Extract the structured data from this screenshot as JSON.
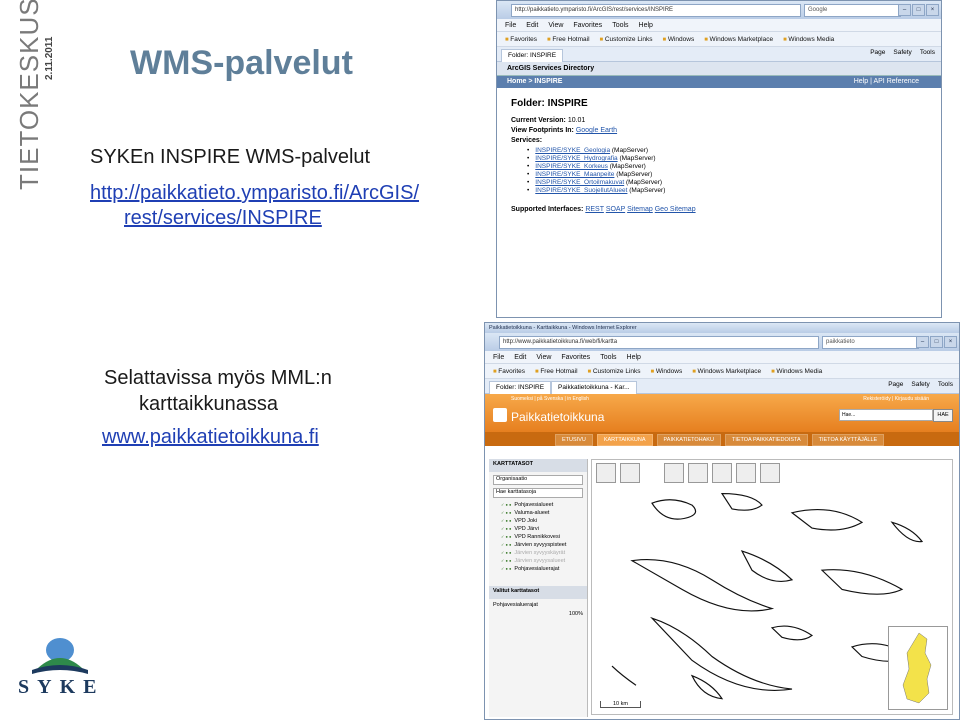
{
  "slide": {
    "brand_vertical": "TIETOKESKUS",
    "date": "2.11.2011",
    "title": "WMS-palvelut",
    "subheading": "SYKEn  INSPIRE WMS-palvelut",
    "link1_line1": "http://paikkatieto.ymparisto.fi/ArcGIS/",
    "link1_line2": "rest/services/INSPIRE",
    "text2_line1": "Selattavissa myös MML:n",
    "text2_line2": "karttaikkunassa",
    "link2": "www.paikkatietoikkuna.fi",
    "logo_word": "SYKE"
  },
  "browser1": {
    "address": "http://paikkatieto.ymparisto.fi/ArcGIS/rest/services/INSPIRE",
    "search_placeholder": "Google",
    "menu": [
      "File",
      "Edit",
      "View",
      "Favorites",
      "Tools",
      "Help"
    ],
    "favorites": [
      "Favorites",
      "Free Hotmail",
      "Customize Links",
      "Windows",
      "Windows Marketplace",
      "Windows Media"
    ],
    "tab": "Folder: INSPIRE",
    "tools": [
      "Page",
      "Safety",
      "Tools"
    ],
    "header": "ArcGIS Services Directory",
    "crumb": "Home > INSPIRE",
    "crumb_right": "Help | API Reference",
    "folder_title": "Folder: INSPIRE",
    "version_label": "Current Version:",
    "version": "10.01",
    "footprints_label": "View Footprints In:",
    "footprints_link": "Google Earth",
    "services_label": "Services:",
    "services": [
      {
        "name": "INSPIRE/SYKE_Geologia",
        "type": "(MapServer)"
      },
      {
        "name": "INSPIRE/SYKE_Hydrografia",
        "type": "(MapServer)"
      },
      {
        "name": "INSPIRE/SYKE_Korkeus",
        "type": "(MapServer)"
      },
      {
        "name": "INSPIRE/SYKE_Maanpeite",
        "type": "(MapServer)"
      },
      {
        "name": "INSPIRE/SYKE_Ortoilmakuvat",
        "type": "(MapServer)"
      },
      {
        "name": "INSPIRE/SYKE_SuojellutAlueet",
        "type": "(MapServer)"
      }
    ],
    "interfaces_label": "Supported Interfaces:",
    "interfaces": [
      "REST",
      "SOAP",
      "Sitemap",
      "Geo Sitemap"
    ]
  },
  "browser2": {
    "window_title": "Paikkatietoikkuna - Karttaikkuna - Windows Internet Explorer",
    "address": "http://www.paikkatietoikkuna.fi/web/fi/kartta",
    "search_placeholder": "paikkatieto",
    "menu": [
      "File",
      "Edit",
      "View",
      "Favorites",
      "Tools",
      "Help"
    ],
    "favorites": [
      "Favorites",
      "Free Hotmail",
      "Customize Links",
      "Windows",
      "Windows Marketplace",
      "Windows Media"
    ],
    "tab1": "Folder: INSPIRE",
    "tab2": "Paikkatietoikkuna - Kar...",
    "tools": [
      "Page",
      "Safety",
      "Tools"
    ],
    "lang": "Suomeksi | på Svenska | in English",
    "login": "Rekisteröidy | Kirjaudu sisään",
    "logo_text": "Paikkatietoikkuna",
    "search_value": "Hae...",
    "search_button": "HAE",
    "nav": [
      "ETUSIVU",
      "KARTTAIKKUNA",
      "PAIKKATIETOHAKU",
      "TIETOA PAIKKATIEDOISTA",
      "TIETOA KÄYTTÄJÄLLE"
    ],
    "panel_title": "KARTTATASOT",
    "panel_select": "Organisaatio",
    "panel_filter": "Hae karttatasoja",
    "layers": [
      {
        "name": "Pohjavesialueet",
        "dim": false
      },
      {
        "name": "Valuma-alueet",
        "dim": false
      },
      {
        "name": "VPD Joki",
        "dim": false
      },
      {
        "name": "VPD Järvi",
        "dim": false
      },
      {
        "name": "VPD Rannikkovesi",
        "dim": false
      },
      {
        "name": "Järvien syvyyspisteet",
        "dim": false
      },
      {
        "name": "Järvien syvyyskäyrät",
        "dim": true
      },
      {
        "name": "Järvien syvyysalueet",
        "dim": true
      },
      {
        "name": "Pohjavesialuerajat",
        "dim": false
      }
    ],
    "selected_title": "Valitut karttatasot",
    "selected_layer": "Pohjavesialuerajat",
    "opacity": "100%",
    "scale": "10 km"
  }
}
